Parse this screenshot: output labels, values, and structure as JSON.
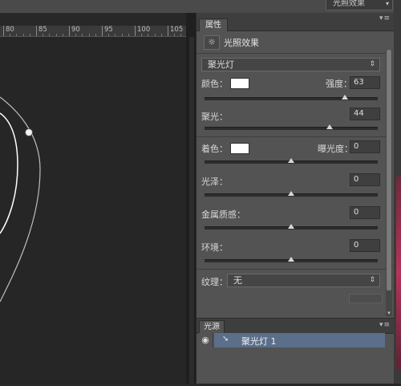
{
  "topbar": {
    "dropdown_label": "光照效果",
    "dropdown_caret": "▾"
  },
  "ruler": {
    "labels": [
      "80",
      "85",
      "90",
      "95",
      "100",
      "105"
    ]
  },
  "panel": {
    "tab_label": "属性",
    "menu_glyph": "▾≡",
    "header_icon": "lighting-effects-icon",
    "header_label": "光照效果",
    "light_type": {
      "value": "聚光灯",
      "caret": "⇕"
    },
    "color": {
      "label": "颜色：",
      "swatch": "#ffffff"
    },
    "intensity": {
      "label": "强度：",
      "value": "63",
      "slider_fraction": 0.81
    },
    "hotspot": {
      "label": "聚光：",
      "value": "44",
      "slider_fraction": 0.72
    },
    "colorize": {
      "label": "着色：",
      "swatch": "#ffffff"
    },
    "exposure": {
      "label": "曝光度：",
      "value": "0",
      "slider_fraction": 0.5
    },
    "gloss": {
      "label": "光泽：",
      "value": "0",
      "slider_fraction": 0.5
    },
    "metallic": {
      "label": "金属质感：",
      "value": "0",
      "slider_fraction": 0.5
    },
    "ambience": {
      "label": "环境：",
      "value": "0",
      "slider_fraction": 0.5
    },
    "texture": {
      "label": "纹理：",
      "value": "无",
      "caret": "⇕"
    },
    "scroll_arrow": "▾"
  },
  "lights_panel": {
    "tab_label": "光源",
    "menu_glyph": "▾≡",
    "eye_icon": "eye-icon",
    "light_icon": "spotlight-icon",
    "light_name": "聚光灯 1"
  }
}
